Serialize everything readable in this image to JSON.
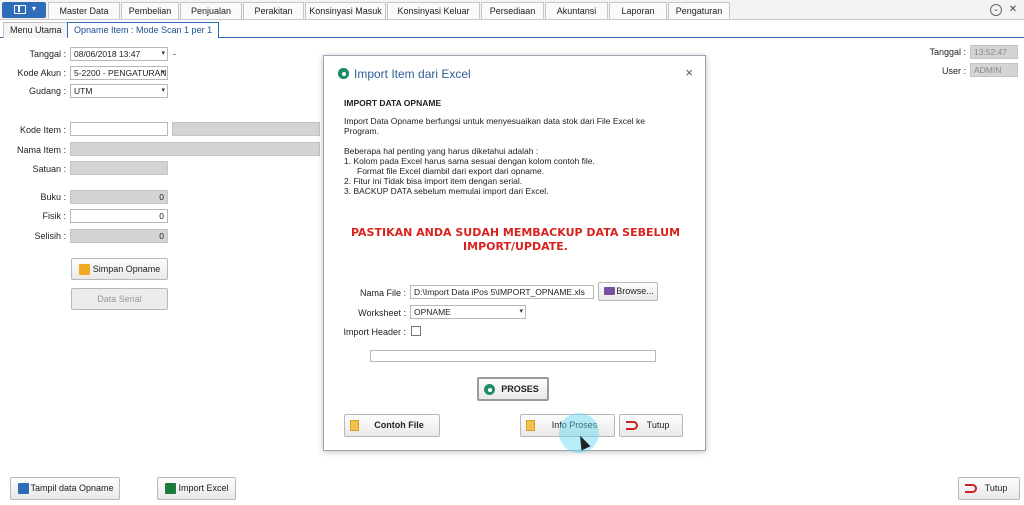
{
  "menu": {
    "items": [
      "Master Data",
      "Pembelian",
      "Penjualan",
      "Perakitan",
      "Konsinyasi Masuk",
      "Konsinyasi Keluar",
      "Persediaan",
      "Akuntansi",
      "Laporan",
      "Pengaturan"
    ],
    "window_controls": [
      "⌄",
      "✕"
    ]
  },
  "tabs": [
    {
      "label": "Menu Utama",
      "active": false
    },
    {
      "label": "Opname Item : Mode Scan 1 per 1",
      "active": true
    }
  ],
  "form": {
    "tanggal_label": "Tanggal :",
    "tanggal_value": "08/06/2018 13:47",
    "tanggal_suffix": "-",
    "kode_akun_label": "Kode Akun :",
    "kode_akun_value": "5-2200 - PENGATURAN",
    "gudang_label": "Gudang :",
    "gudang_value": "UTM",
    "kode_item_label": "Kode Item :",
    "kode_item_value": "",
    "nama_item_label": "Nama Item :",
    "satuan_label": "Satuan :",
    "buku_label": "Buku :",
    "buku_value": "0",
    "fisik_label": "Fisik :",
    "fisik_value": "0",
    "selisih_label": "Selisih :",
    "selisih_value": "0",
    "simpan_label": "Simpan Opname",
    "data_serial_label": "Data Serial"
  },
  "right_info": {
    "tanggal_label": "Tanggal :",
    "tanggal_value": "13:52:47",
    "user_label": "User :",
    "user_value": "ADMIN"
  },
  "bottom": {
    "tampil_label": "Tampil data Opname",
    "import_label": "Import Excel",
    "tutup_label": "Tutup"
  },
  "dialog": {
    "title": "Import Item dari Excel",
    "close": "×",
    "heading": "IMPORT DATA OPNAME",
    "desc_1": "Import Data Opname berfungsi untuk menyesuaikan data stok dari File Excel ke",
    "desc_2": "Program.",
    "note_intro": "Beberapa hal penting yang harus diketahui adalah :",
    "note_1": "1. Kolom pada Excel harus sama sesuai dengan kolom contoh file.",
    "note_1b": "Format file Excel diambil dari export dari opname.",
    "note_2": "2. Fitur ini Tidak bisa import item dengan serial.",
    "note_3": "3. BACKUP DATA sebelum memulai import dari Excel.",
    "warning_1": "PASTIKAN ANDA SUDAH MEMBACKUP DATA SEBELUM",
    "warning_2": "IMPORT/UPDATE.",
    "nama_file_label": "Nama File :",
    "nama_file_value": "D:\\Import Data iPos 5\\IMPORT_OPNAME.xls",
    "browse_label": "Browse...",
    "worksheet_label": "Worksheet :",
    "worksheet_value": "OPNAME",
    "import_header_label": "Import Header :",
    "proses_label": "PROSES",
    "contoh_file_label": "Contoh File",
    "info_proses_label": "Info Proses",
    "tutup_label": "Tutup"
  }
}
